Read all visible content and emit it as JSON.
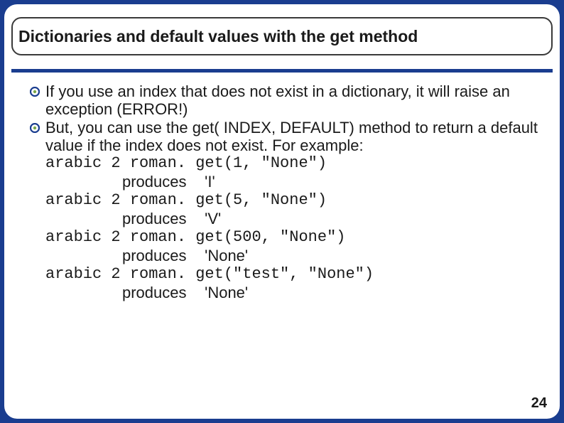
{
  "title": "Dictionaries and default values with the get method",
  "bullets": [
    "If you use an index that does not exist in a dictionary, it will raise an exception (ERROR!)",
    "But, you can use the get( INDEX, DEFAULT) method to return a default value if the index does not exist. For example:"
  ],
  "examples": [
    {
      "code": "arabic 2 roman. get(1, \"None\")",
      "result": "'I'"
    },
    {
      "code": "arabic 2 roman. get(5, \"None\")",
      "result": "'V'"
    },
    {
      "code": "arabic 2 roman. get(500, \"None\")",
      "result": "'None'"
    },
    {
      "code": "arabic 2 roman. get(\"test\", \"None\")",
      "result": "'None'"
    }
  ],
  "result_label": "produces",
  "page_number": "24"
}
